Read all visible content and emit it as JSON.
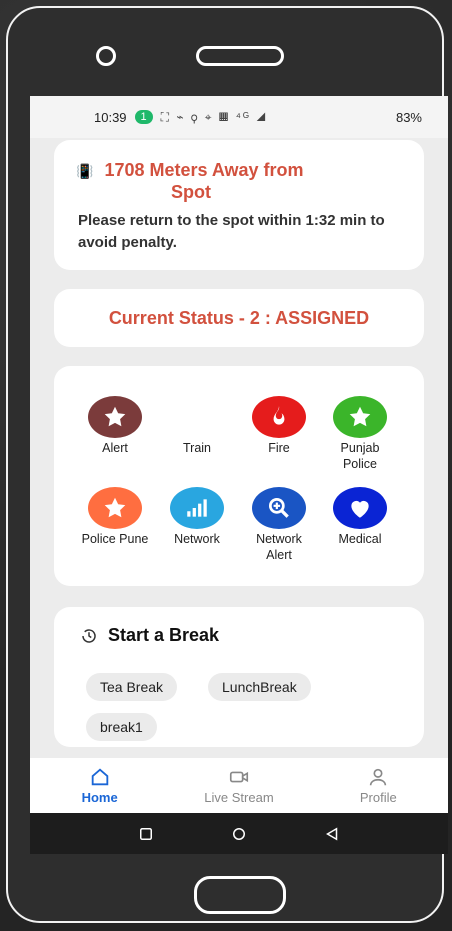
{
  "status_bar": {
    "time": "10:39",
    "pill": "1",
    "icons_text": "⛶ ⌁ ⚲ ⌖ ▦ ⁴ᴳ ◢",
    "battery": "83%"
  },
  "distance_alert": {
    "icon": "vibration-icon",
    "line1": "1708  Meters Away from",
    "line2": "Spot",
    "message": "Please return to the spot within 1:32 min to avoid penalty."
  },
  "current_status": {
    "text": "Current Status - 2 : ASSIGNED"
  },
  "services": [
    {
      "label": "Alert",
      "icon": "star-icon",
      "color": "#7b3b3b"
    },
    {
      "label": "Train",
      "icon": "none",
      "color": "#ffffff"
    },
    {
      "label": "Fire",
      "icon": "flame-icon",
      "color": "#e51c1c"
    },
    {
      "label": "Punjab Police",
      "icon": "star-icon",
      "color": "#3bb52a"
    },
    {
      "label": "Police Pune",
      "icon": "star-icon",
      "color": "#ff6e40"
    },
    {
      "label": "Network",
      "icon": "signal-bars-icon",
      "color": "#29a6e0"
    },
    {
      "label": "Network Alert",
      "icon": "zoom-in-icon",
      "color": "#1a55c4"
    },
    {
      "label": "Medical",
      "icon": "heart-icon",
      "color": "#0a24d4"
    }
  ],
  "break_section": {
    "title": "Start a Break",
    "chips": [
      "Tea Break",
      "LunchBreak",
      "break1"
    ]
  },
  "bottom_nav": [
    {
      "label": "Home",
      "icon": "home-icon",
      "active": true
    },
    {
      "label": "Live Stream",
      "icon": "video-camera-icon",
      "active": false
    },
    {
      "label": "Profile",
      "icon": "user-icon",
      "active": false
    }
  ],
  "colors": {
    "accent_red": "#d2513e",
    "active_blue": "#1a66d6"
  }
}
